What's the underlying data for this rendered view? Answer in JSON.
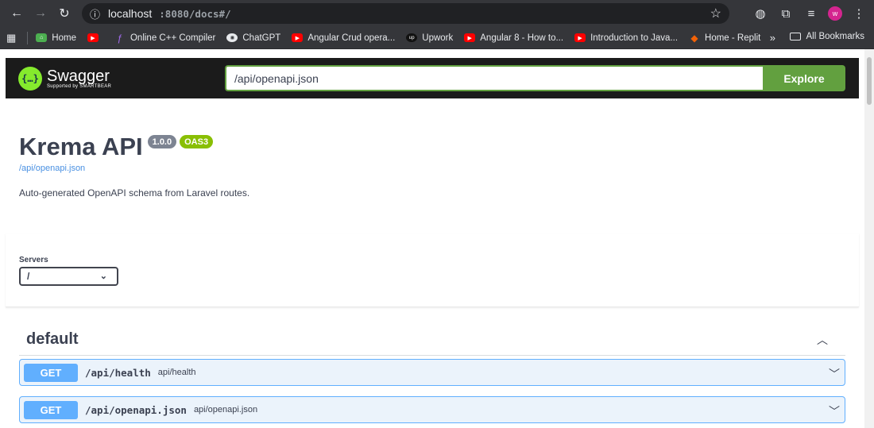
{
  "browser": {
    "url_host": "localhost",
    "url_path": ":8080/docs#/",
    "avatar_letter": "w"
  },
  "bookmarks": {
    "items": [
      {
        "label": "Home",
        "icon": "home"
      },
      {
        "label": "",
        "icon": "yt"
      },
      {
        "label": "Online C++ Compiler",
        "icon": "cpp"
      },
      {
        "label": "ChatGPT",
        "icon": "gpt"
      },
      {
        "label": "Angular Crud opera...",
        "icon": "yt"
      },
      {
        "label": "Upwork",
        "icon": "up"
      },
      {
        "label": "Angular 8 - How to...",
        "icon": "yt"
      },
      {
        "label": "Introduction to Java...",
        "icon": "yt"
      },
      {
        "label": "Home - Replit",
        "icon": "rep"
      }
    ],
    "more": "»",
    "all_label": "All Bookmarks"
  },
  "swagger": {
    "logo_title": "Swagger",
    "logo_sub": "Supported by SMARTBEAR",
    "spec_url": "/api/openapi.json",
    "explore_label": "Explore"
  },
  "info": {
    "title": "Krema API",
    "version": "1.0.0",
    "oas": "OAS3",
    "spec_link": "/api/openapi.json",
    "description": "Auto-generated OpenAPI schema from Laravel routes."
  },
  "servers": {
    "label": "Servers",
    "selected": "/"
  },
  "tag": {
    "name": "default"
  },
  "operations": [
    {
      "method": "GET",
      "path": "/api/health",
      "summary": "api/health"
    },
    {
      "method": "GET",
      "path": "/api/openapi.json",
      "summary": "api/openapi.json"
    }
  ],
  "colors": {
    "swagger_green": "#62a03f",
    "get_blue": "#61affe",
    "oas_badge": "#89bf04",
    "version_badge": "#7d8492"
  }
}
